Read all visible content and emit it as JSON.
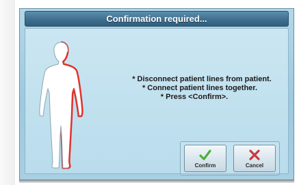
{
  "dialog": {
    "title": "Confirmation required...",
    "messages": [
      "* Disconnect patient lines from patient.",
      "* Connect patient lines together.",
      "* Press <Confirm>."
    ],
    "buttons": {
      "confirm_label": "Confirm",
      "cancel_label": "Cancel"
    },
    "icons": {
      "figure": "human-body-icon",
      "confirm": "checkmark-icon",
      "cancel": "cross-icon"
    }
  },
  "colors": {
    "titlebar": "#3f6f8e",
    "panel": "#b9dcec",
    "highlight_red": "#e0322d",
    "confirm_green": "#4cae3c",
    "cancel_red": "#c83a3a"
  }
}
